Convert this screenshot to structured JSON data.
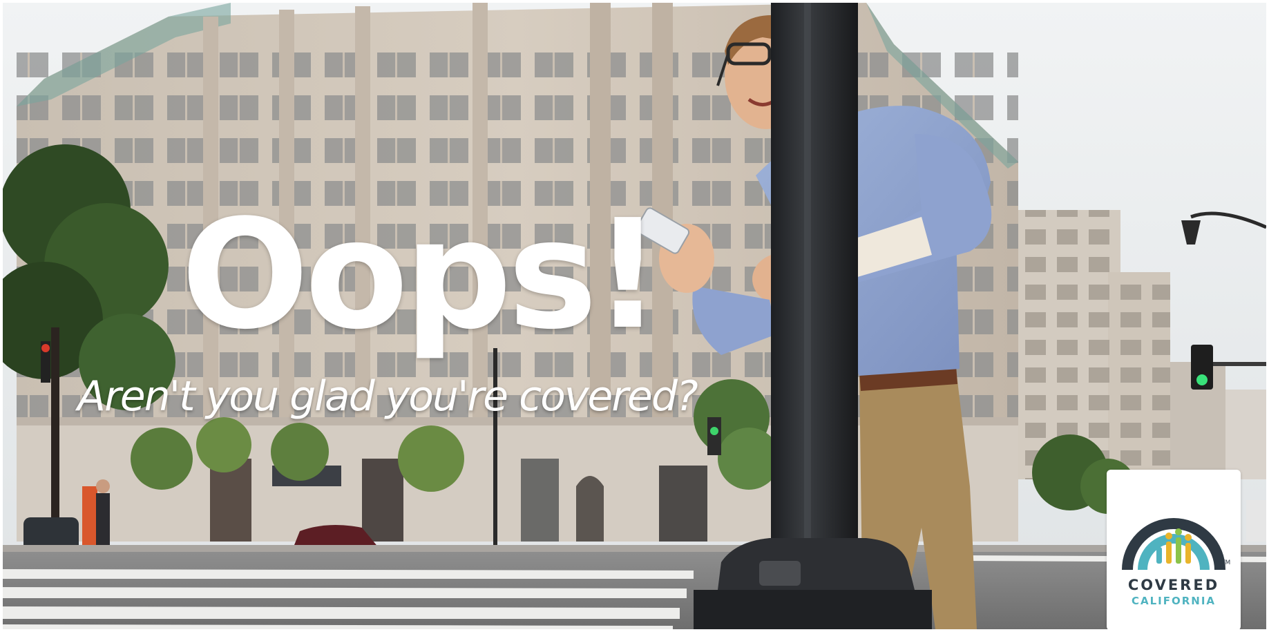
{
  "ad": {
    "headline": "Oops!",
    "subline": "Aren't you glad you're covered?"
  },
  "logo": {
    "line1": "COVERED",
    "line2": "CALIFORNIA",
    "tm": "TM"
  },
  "colors": {
    "text": "#ffffff",
    "logo_dark": "#2f3a44",
    "logo_teal": "#4fb3c0",
    "logo_gold": "#e9b42b",
    "logo_green": "#8bc34a"
  }
}
